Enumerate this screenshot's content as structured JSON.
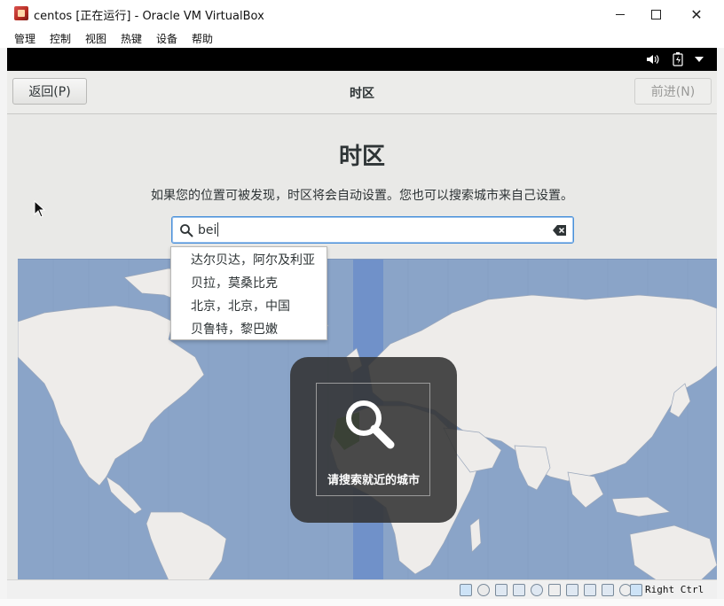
{
  "host_window": {
    "title": "centos [正在运行] - Oracle VM VirtualBox",
    "menu": [
      "管理",
      "控制",
      "视图",
      "热键",
      "设备",
      "帮助"
    ]
  },
  "installer": {
    "header_title": "时区",
    "back_label": "返回(P)",
    "next_label": "前进(N)",
    "page_title": "时区",
    "subtitle": "如果您的位置可被发现，时区将会自动设置。您也可以搜索城市来自己设置。",
    "search": {
      "value": "bei"
    },
    "suggestions": [
      "达尔贝达，阿尔及利亚",
      "贝拉，莫桑比克",
      "北京，北京，中国",
      "贝鲁特，黎巴嫩"
    ],
    "overlay_text": "请搜索就近的城市"
  },
  "status_bar": {
    "host_key": "Right Ctrl"
  },
  "colors": {
    "ocean": "#8aa4c8",
    "land": "#eeecea",
    "selected_band": "#6d8fc9",
    "focus_blue": "#4a90d9"
  },
  "icons": [
    "search-icon",
    "clear-icon",
    "speaker-icon",
    "battery-icon",
    "dropdown-arrow-icon",
    "magnifier-icon"
  ]
}
